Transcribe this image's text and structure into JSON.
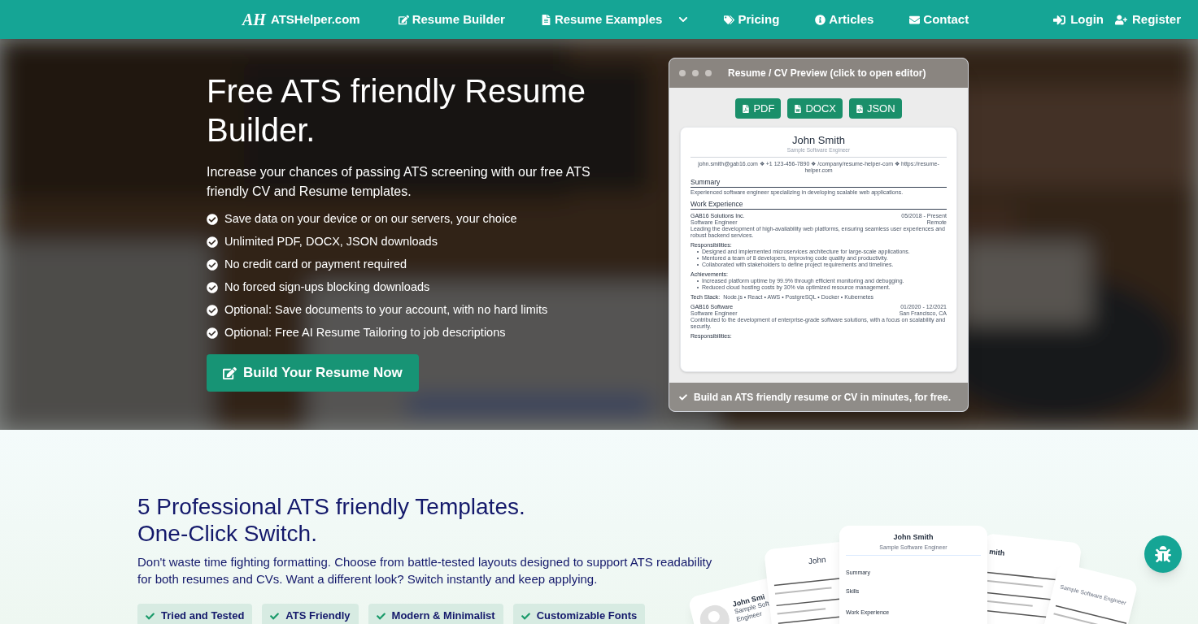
{
  "nav": {
    "brand_mark": "AH",
    "brand": "ATSHelper.com",
    "items": [
      {
        "label": "Resume Builder",
        "dropdown": false
      },
      {
        "label": "Resume Examples",
        "dropdown": true
      },
      {
        "label": "Pricing",
        "dropdown": false
      },
      {
        "label": "Articles",
        "dropdown": false
      },
      {
        "label": "Contact",
        "dropdown": false
      }
    ],
    "auth": [
      "Login",
      "Register"
    ]
  },
  "hero": {
    "title": "Free ATS friendly Resume Builder.",
    "subtitle": "Increase your chances of passing ATS screening with our free ATS friendly CV and Resume templates.",
    "features": [
      "Save data on your device or on our servers, your choice",
      "Unlimited PDF, DOCX, JSON downloads",
      "No credit card or payment required",
      "No forced sign-ups blocking downloads",
      "Optional: Save documents to your account, with no hard limits",
      "Optional: Free AI Resume Tailoring to job descriptions"
    ],
    "cta": "Build Your Resume Now"
  },
  "preview": {
    "title": "Resume / CV Preview (click to open editor)",
    "downloads": [
      "PDF",
      "DOCX",
      "JSON"
    ],
    "footer": "Build an ATS friendly resume or CV in minutes, for free.",
    "resume": {
      "name": "John Smith",
      "subtitle": "Sample Software Engineer",
      "contact": "john.smith@gab16.com ❖ +1 123-456-7890 ❖ /company/resume-helper-com ❖ https://resume-helper.com",
      "summary_heading": "Summary",
      "summary": "Experienced software engineer specializing in developing scalable web applications.",
      "work_heading": "Work Experience",
      "jobs": [
        {
          "company": "GAB16 Solutions Inc.",
          "dates": "05/2018 - Present",
          "role": "Software Engineer",
          "location": "Remote",
          "description": "Leading the development of high-availability web platforms, ensuring seamless user experiences and robust backend services.",
          "blocks": [
            {
              "heading": "Responsibilities:",
              "items": [
                "Designed and implemented microservices architecture for large-scale applications.",
                "Mentored a team of 8 developers, improving code quality and productivity.",
                "Collaborated with stakeholders to define project requirements and timelines."
              ]
            },
            {
              "heading": "Achievements:",
              "items": [
                "Increased platform uptime by 99.9% through efficient monitoring and debugging.",
                "Reduced cloud hosting costs by 30% via optimized resource management."
              ]
            }
          ],
          "tech_label": "Tech Stack:",
          "tech": "Node.js • React • AWS • PostgreSQL • Docker • Kubernetes"
        },
        {
          "company": "GAB16 Software",
          "dates": "01/2020 - 12/2021",
          "role": "Software Engineer",
          "location": "San Francisco, CA",
          "description": "Contributed to the development of enterprise-grade software solutions, with a focus on scalability and security.",
          "blocks": [
            {
              "heading": "Responsibilities:"
            }
          ]
        }
      ]
    }
  },
  "templates": {
    "title_lines": [
      "5 Professional ATS friendly Templates.",
      "One-Click Switch."
    ],
    "text": "Don't waste time fighting formatting. Choose from battle-tested layouts designed to support ATS readability for both resumes and CVs. Want a different look? Switch instantly and keep applying.",
    "badges": [
      "Tried and Tested",
      "ATS Friendly",
      "Modern & Minimalist",
      "Customizable Fonts"
    ],
    "cards": [
      {
        "lines": [
          "John Smi",
          "Sample Soft",
          "Engineer"
        ]
      },
      {
        "kind": "left",
        "lines": [
          "John"
        ]
      },
      {
        "kind": "right",
        "lines": [
          "mith"
        ]
      },
      {
        "kind": "far",
        "lines": [
          "Sample Software Engineer"
        ]
      },
      {
        "kind": "center",
        "lines": [
          "John Smith",
          "Sample Software Engineer",
          "Summary",
          "Skills",
          "Work Experience"
        ]
      }
    ]
  }
}
